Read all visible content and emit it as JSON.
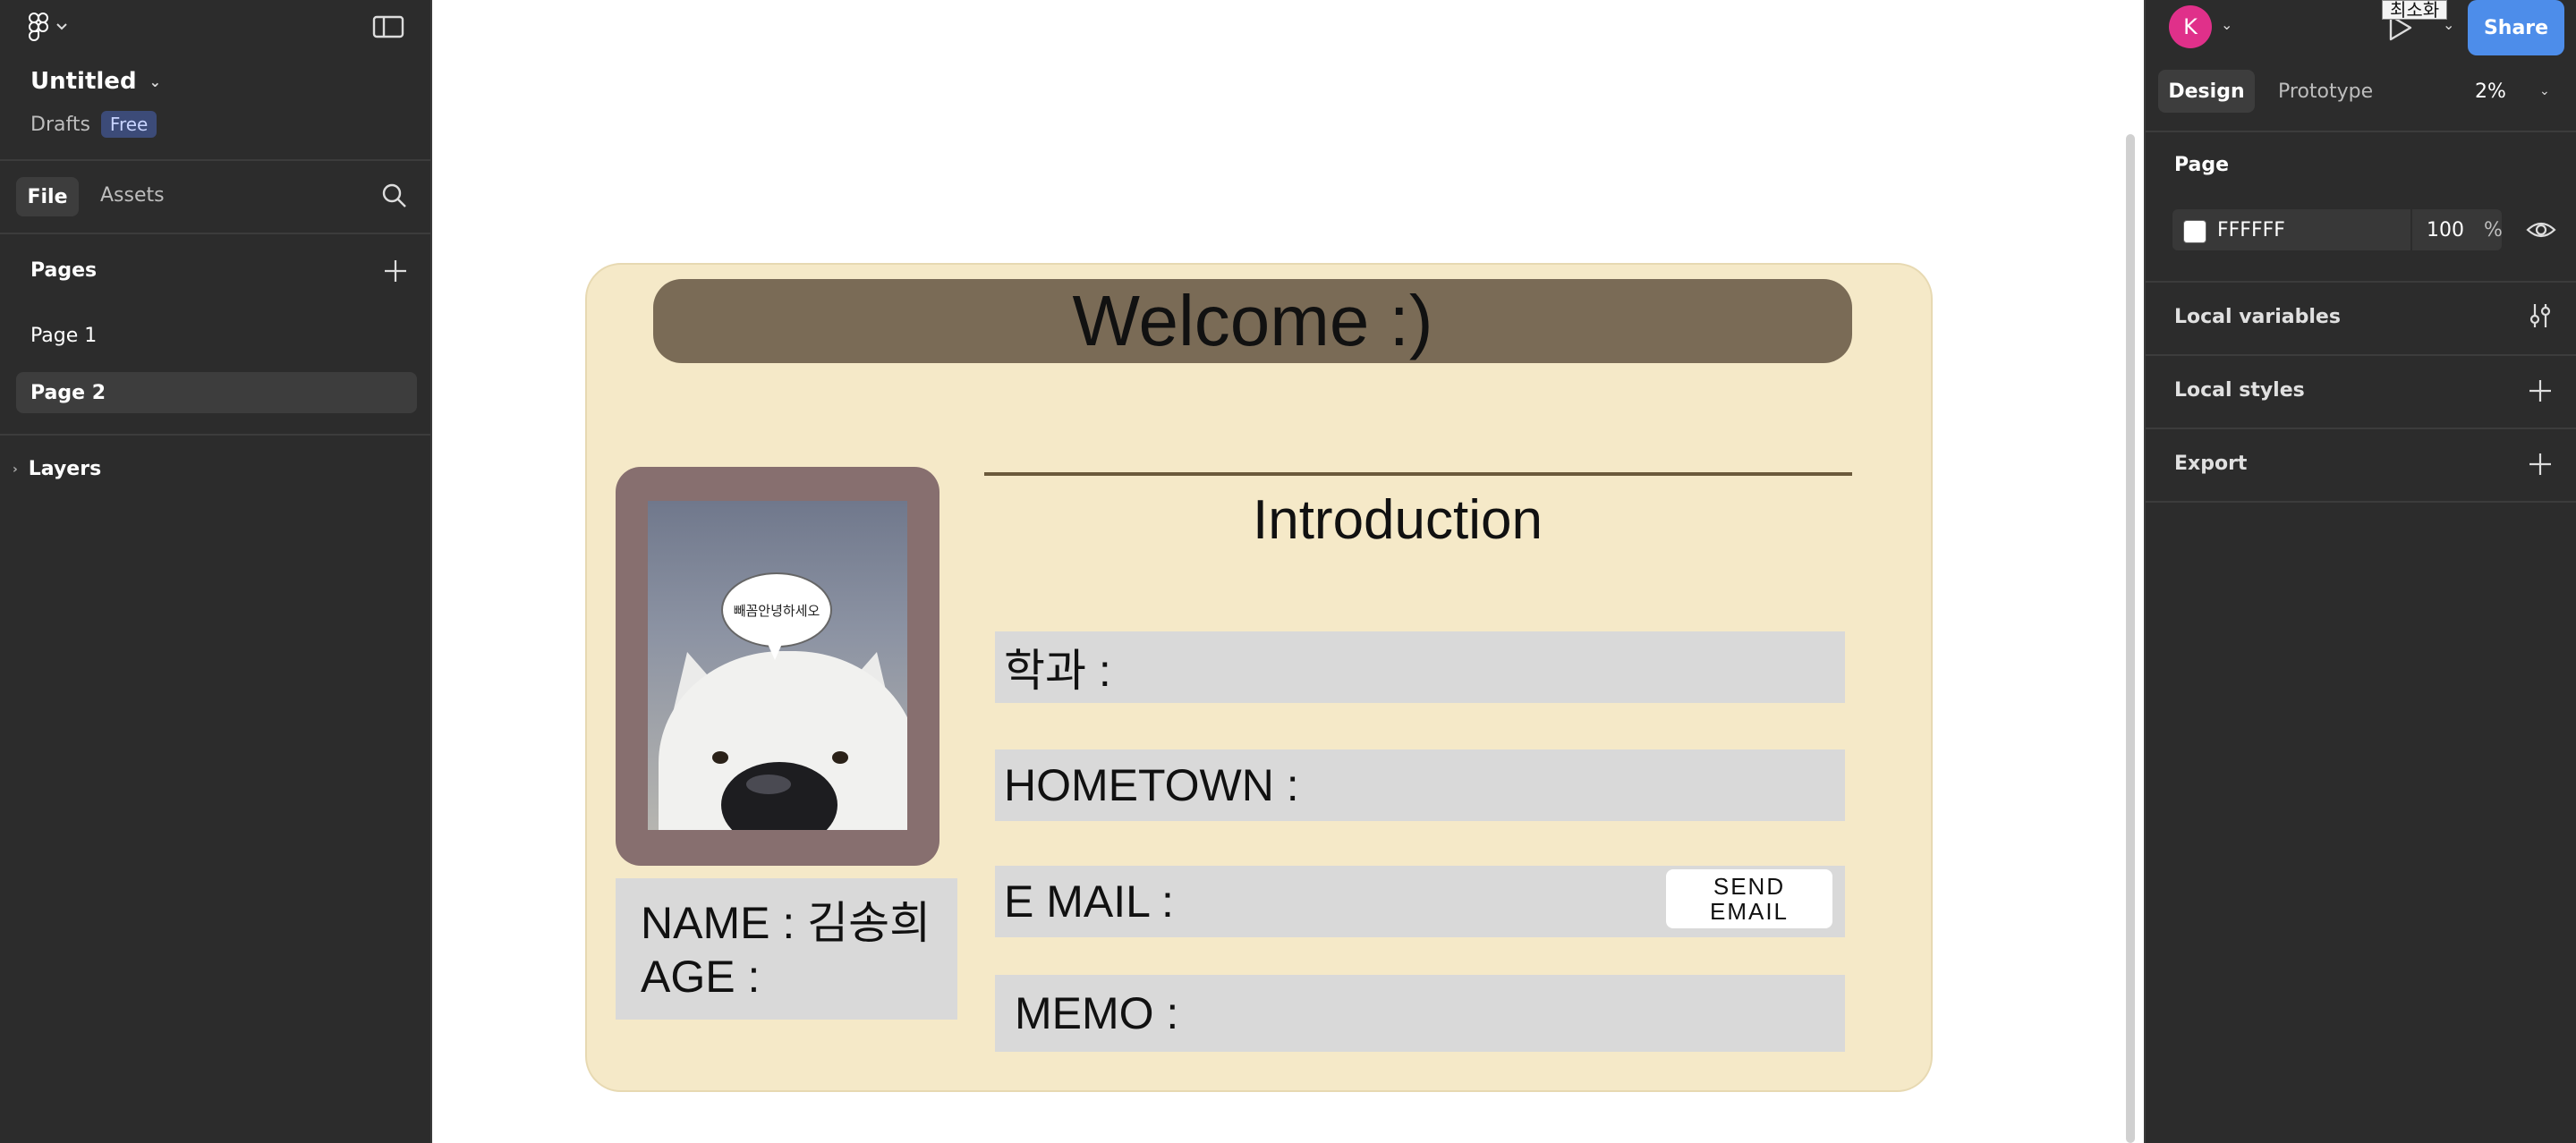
{
  "left_panel": {
    "file_name": "Untitled",
    "location": "Drafts",
    "plan_badge": "Free",
    "tabs": {
      "file": "File",
      "assets": "Assets"
    },
    "pages_heading": "Pages",
    "pages": [
      {
        "label": "Page 1"
      },
      {
        "label": "Page 2",
        "active": true
      }
    ],
    "layers_heading": "Layers"
  },
  "right_panel": {
    "avatar_initial": "K",
    "tooltip": "최소화",
    "share_label": "Share",
    "tabs": {
      "design": "Design",
      "prototype": "Prototype"
    },
    "zoom": "2%",
    "page_section": {
      "title": "Page",
      "fill_hex": "FFFFFF",
      "fill_color": "#ffffff",
      "opacity": "100",
      "opacity_unit": "%"
    },
    "local_variables": "Local variables",
    "local_styles": "Local styles",
    "export": "Export"
  },
  "canvas": {
    "card_bg": "#f5e9c8",
    "banner_color": "#7a6b56",
    "welcome": "Welcome :)",
    "photo_caption": "빼꼼안녕하세오",
    "name_line": "NAME : 김송희",
    "age_line": "AGE :",
    "intro_title": "Introduction",
    "fields": [
      {
        "label": "학과 :"
      },
      {
        "label": "HOMETOWN :"
      },
      {
        "label": "E MAIL :"
      },
      {
        "label": "MEMO :"
      }
    ],
    "send_email": "SEND\nEMAIL"
  },
  "colors": {
    "panel_bg": "#2c2c2c",
    "accent": "#4d8dea",
    "avatar": "#e0308a"
  }
}
